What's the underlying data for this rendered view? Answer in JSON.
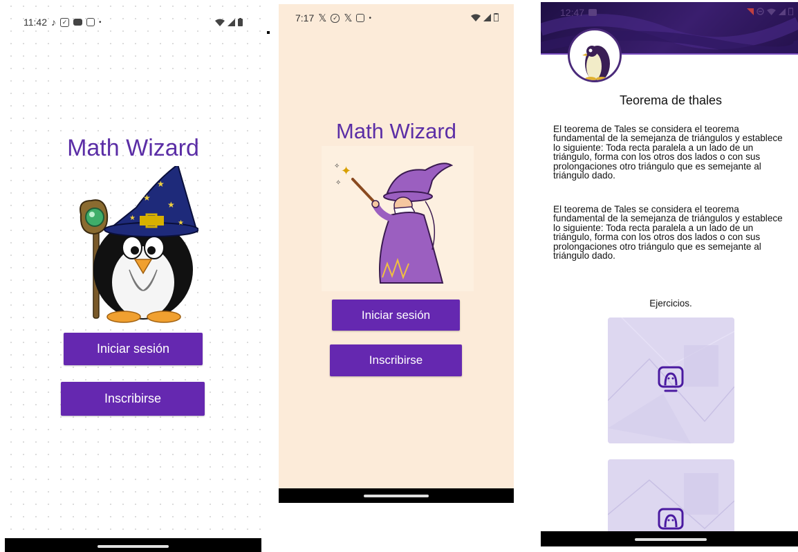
{
  "screen1": {
    "status_time": "11:42",
    "title": "Math Wizard",
    "login_button": "Iniciar sesión",
    "signup_button": "Inscribirse"
  },
  "screen2": {
    "status_time": "7:17",
    "title": "Math Wizard",
    "login_button": "Iniciar sesión",
    "signup_button": "Inscribirse"
  },
  "screen3": {
    "status_time": "12:47",
    "title": "Teorema de thales",
    "paragraph_1_lines": [
      "El teorema de Tales se considera el teorema",
      "fundamental de la semejanza de triángulos y establece",
      "lo siguiente: Toda recta paralela a un lado de un",
      "triángulo, forma con los otros dos lados o con sus",
      "prolongaciones otro triángulo que es semejante al",
      "triángulo dado."
    ],
    "paragraph_2_lines": [
      "El teorema de Tales se considera el teorema",
      "fundamental de la semejanza de triángulos y establece",
      "lo siguiente: Toda recta paralela a un lado de un",
      "triángulo, forma con los otros dos lados o con sus",
      "prolongaciones otro triángulo que es semejante al",
      "triángulo dado."
    ],
    "exercises_label": "Ejercicios."
  },
  "colors": {
    "accent": "#6528b0",
    "title_purple": "#5b2ea6",
    "screen2_background": "#fcebd9",
    "header_purple": "#2b1556"
  }
}
